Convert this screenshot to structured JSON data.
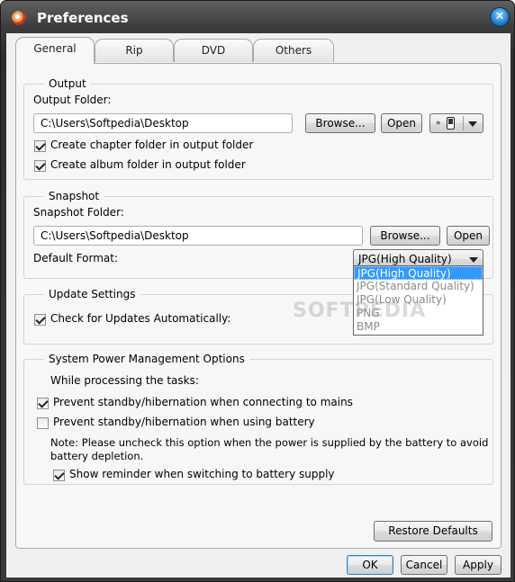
{
  "window": {
    "title": "Preferences",
    "close_glyph": "✕"
  },
  "tabs": [
    {
      "label": "General",
      "active": true
    },
    {
      "label": "Rip",
      "active": false
    },
    {
      "label": "DVD",
      "active": false
    },
    {
      "label": "Others",
      "active": false
    }
  ],
  "output": {
    "group_title": "Output",
    "folder_label": "Output Folder:",
    "folder_value": "C:\\Users\\Softpedia\\Desktop",
    "browse_label": "Browse...",
    "open_label": "Open",
    "device_icon": "device-phone-icon",
    "chapter_folder_label": "Create chapter folder in output folder",
    "chapter_folder_checked": true,
    "album_folder_label": "Create album folder in output folder",
    "album_folder_checked": true
  },
  "snapshot": {
    "group_title": "Snapshot",
    "folder_label": "Snapshot Folder:",
    "folder_value": "C:\\Users\\Softpedia\\Desktop",
    "browse_label": "Browse...",
    "open_label": "Open",
    "format_label": "Default Format:",
    "format_selected": "JPG(High Quality)",
    "format_options": [
      "JPG(High Quality)",
      "JPG(Standard Quality)",
      "JPG(Low Quality)",
      "PNG",
      "BMP"
    ]
  },
  "update": {
    "group_title": "Update Settings",
    "auto_check_label": "Check for Updates Automatically:",
    "auto_check_checked": true
  },
  "power": {
    "group_title": "System Power Management Options",
    "subtitle": "While processing the tasks:",
    "mains_label": "Prevent standby/hibernation when connecting to mains",
    "mains_checked": true,
    "battery_label": "Prevent standby/hibernation when using battery",
    "battery_checked": false,
    "note_line1": "Note: Please uncheck this option when the power is supplied by the battery to avoid",
    "note_line2": "battery depletion.",
    "reminder_label": "Show reminder when switching to battery supply",
    "reminder_checked": true
  },
  "footer": {
    "restore_label": "Restore Defaults",
    "ok_label": "OK",
    "cancel_label": "Cancel",
    "apply_label": "Apply"
  },
  "watermark": "SOFTPEDIA"
}
